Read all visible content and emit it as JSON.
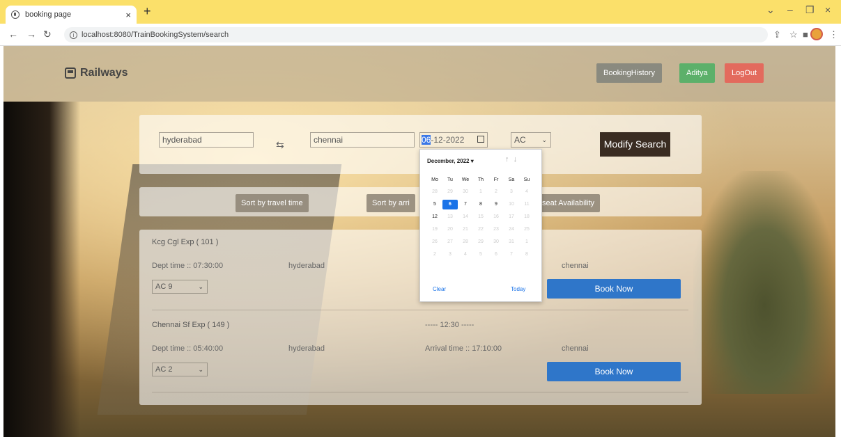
{
  "browser": {
    "tab_title": "booking page",
    "url": "localhost:8080/TrainBookingSystem/search"
  },
  "header": {
    "brand": "Railways",
    "booking_history": "BookingHistory",
    "user": "Aditya",
    "logout": "LogOut"
  },
  "search": {
    "from": "hyderabad",
    "to": "chennai",
    "date_highlight": "06",
    "date_rest": "-12-2022",
    "class": "AC",
    "modify": "Modify Search"
  },
  "sort": {
    "travel_time": "Sort by travel time",
    "arrival": "Sort by arri",
    "seat": "seat Availability"
  },
  "results": [
    {
      "name": "Kcg Cgl Exp ( 101 )",
      "dept": "Dept time :: 07:30:00",
      "from": "hyderabad",
      "to": "chennai",
      "class": "AC 9",
      "book": "Book Now"
    },
    {
      "name": "Chennai Sf Exp ( 149 )",
      "duration": "----- 12:30 -----",
      "dept": "Dept time :: 05:40:00",
      "from": "hyderabad",
      "arrival": "Arrival time :: 17:10:00",
      "to": "chennai",
      "class": "AC 2",
      "book": "Book Now"
    }
  ],
  "datepicker": {
    "month": "December, 2022 ▾",
    "days": [
      "Mo",
      "Tu",
      "We",
      "Th",
      "Fr",
      "Sa",
      "Su"
    ],
    "clear": "Clear",
    "today": "Today"
  }
}
